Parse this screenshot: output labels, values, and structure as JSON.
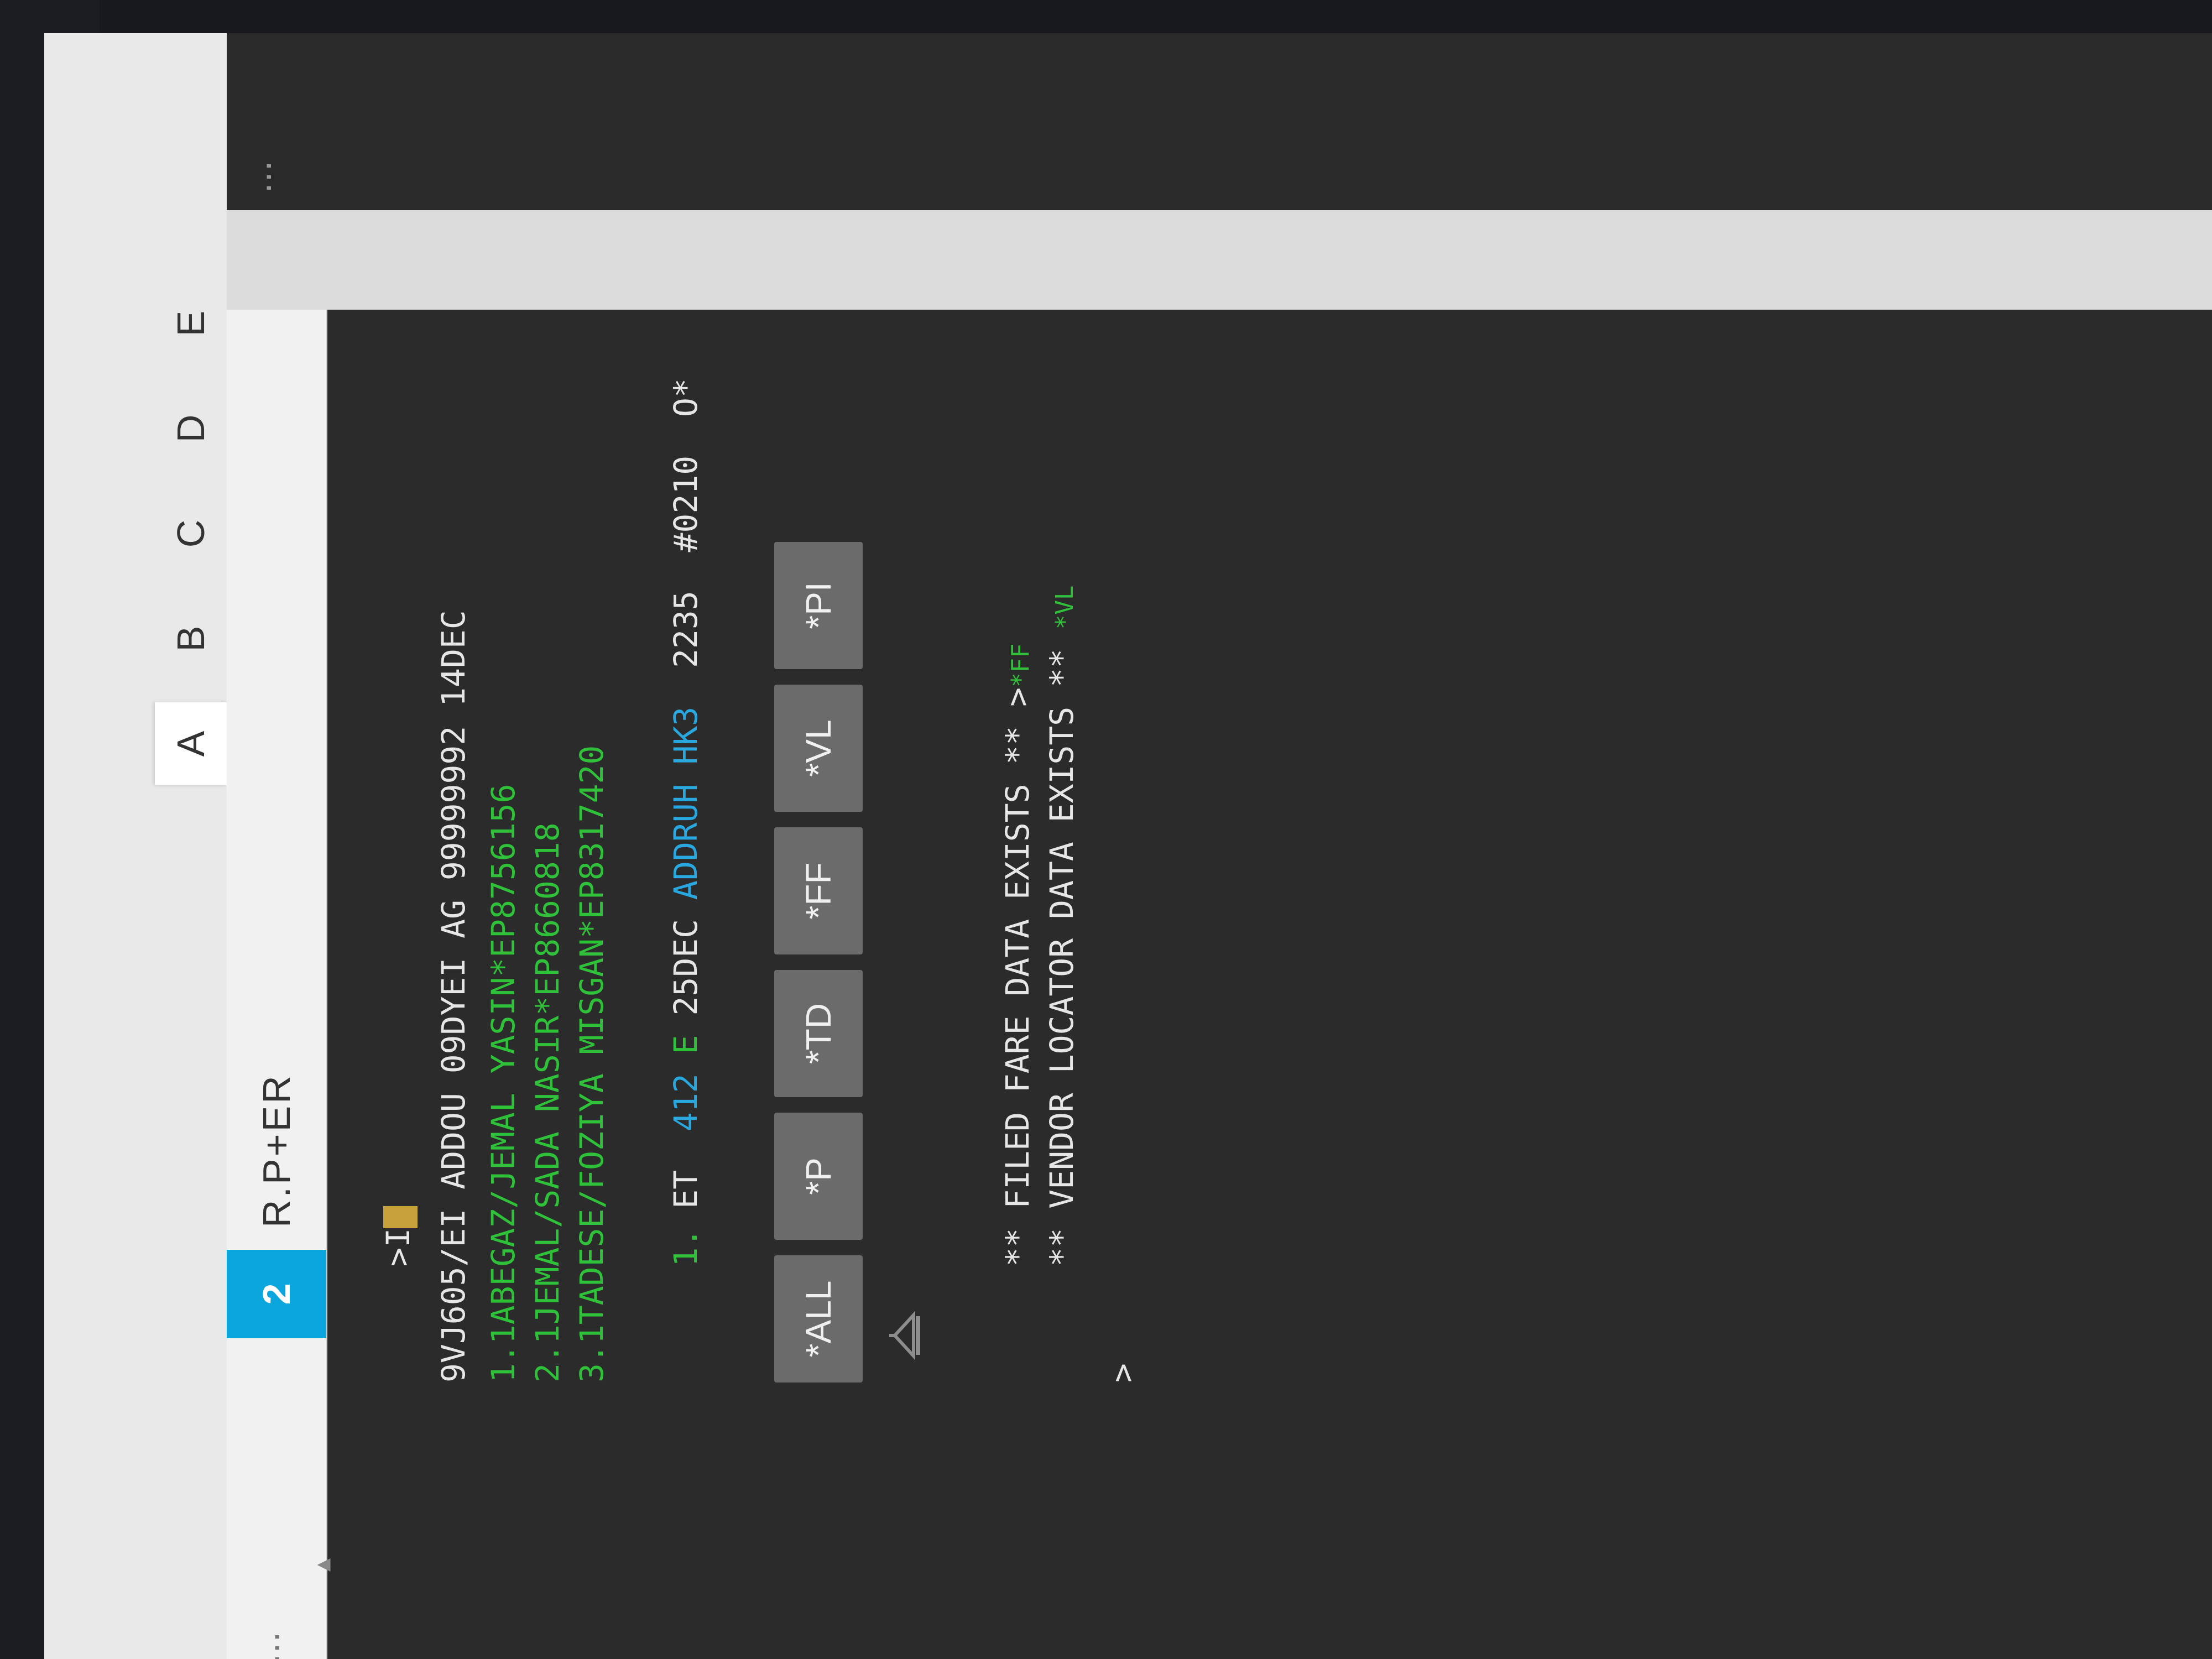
{
  "panes": [
    "A",
    "B",
    "C",
    "D",
    "E"
  ],
  "active_pane": "A",
  "tab": {
    "number": "2",
    "title": "R.P+ER",
    "menu_icon": "ellipsis-icon"
  },
  "terminal": {
    "prompt_cmd": ">I",
    "header": "9VJ605/EI ADDOU 09DYEI AG 99999992 14DEC",
    "passengers": [
      "1.1ABEGAZ/JEMAL YASIN*EP8756156",
      "2.1JEMAL/SADA NASIR*EP8660818",
      "3.1TADESE/FOZIYA MISGAN*EP8317420"
    ],
    "segment": {
      "num": "1.",
      "carrier": "ET",
      "flight": "412",
      "class": "E",
      "date": "25DEC",
      "route": "ADDRUH",
      "status": "HK3",
      "dep": "2235",
      "ref": "#0210",
      "extra": "O*"
    },
    "buttons": [
      "*ALL",
      "*P",
      "*TD",
      "*FF",
      "*VL",
      "*PI"
    ],
    "messages": {
      "fare": "** FILED FARE DATA EXISTS ** >",
      "fare_link": "*FF",
      "vendor": "** VENDOR LOCATOR DATA EXISTS **",
      "vendor_link": "*VL"
    },
    "final_prompt": ">"
  },
  "colors": {
    "background": "#2b2b2b",
    "text": "#e6e6e6",
    "green": "#2fc13a",
    "cyan": "#29a8e0",
    "tab_accent": "#0aa6dd",
    "cursor": "#c7a23a"
  }
}
